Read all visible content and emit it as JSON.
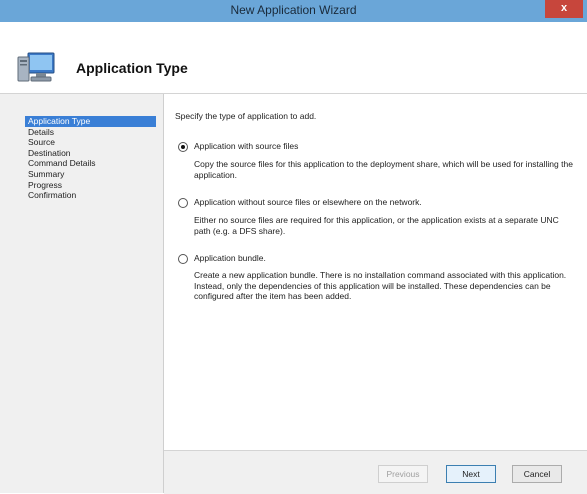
{
  "window": {
    "title": "New Application Wizard",
    "close_label": "x"
  },
  "header": {
    "title": "Application Type",
    "icon": "computer-icon"
  },
  "sidebar": {
    "items": [
      {
        "label": "Application Type",
        "active": true
      },
      {
        "label": "Details"
      },
      {
        "label": "Source"
      },
      {
        "label": "Destination"
      },
      {
        "label": "Command Details"
      },
      {
        "label": "Summary"
      },
      {
        "label": "Progress"
      },
      {
        "label": "Confirmation"
      }
    ]
  },
  "main": {
    "instruction": "Specify the type of application to add.",
    "options": [
      {
        "label": "Application with source files",
        "selected": true,
        "description": "Copy the source files for this application to the deployment share, which will be used for installing the application."
      },
      {
        "label": "Application without source files or elsewhere on the network.",
        "selected": false,
        "description": "Either no source files are required for this application, or the application exists at a separate UNC path (e.g. a DFS share)."
      },
      {
        "label": "Application bundle.",
        "selected": false,
        "description": "Create a new application bundle.  There is no installation command associated with this application.  Instead, only the dependencies of this application will be installed.  These dependencies can be configured after the item has been added."
      }
    ]
  },
  "footer": {
    "previous_label": "Previous",
    "next_label": "Next",
    "cancel_label": "Cancel"
  },
  "colors": {
    "titlebar": "#6aa6d8",
    "selection": "#3a7fd6",
    "close": "#c7463c"
  }
}
